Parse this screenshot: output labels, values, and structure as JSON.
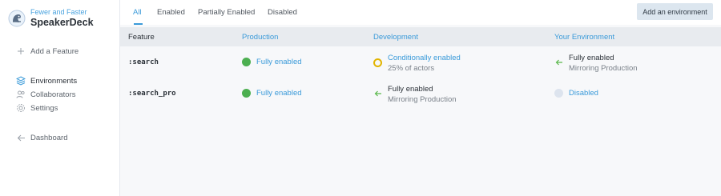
{
  "brand": {
    "org": "Fewer and Faster",
    "app": "SpeakerDeck"
  },
  "sidebar": {
    "add_feature": "Add a Feature",
    "environments": "Environments",
    "collaborators": "Collaborators",
    "settings": "Settings",
    "dashboard": "Dashboard"
  },
  "tabs": [
    "All",
    "Enabled",
    "Partially Enabled",
    "Disabled"
  ],
  "active_tab": "All",
  "add_environment_button": "Add an environment",
  "table": {
    "headers": {
      "feature": "Feature",
      "production": "Production",
      "development": "Development",
      "your_environment": "Your Environment"
    },
    "rows": [
      {
        "feature": ":search",
        "production": {
          "status": "Fully enabled",
          "icon": "green-dot-icon"
        },
        "development": {
          "status": "Conditionally enabled",
          "detail": "25% of actors",
          "icon": "yellow-ring-icon"
        },
        "your_environment": {
          "status": "Fully enabled",
          "detail": "Mirroring Production",
          "icon": "arrow-left-icon"
        }
      },
      {
        "feature": ":search_pro",
        "production": {
          "status": "Fully enabled",
          "icon": "green-dot-icon"
        },
        "development": {
          "status": "Fully enabled",
          "detail": "Mirroring Production",
          "icon": "arrow-left-icon"
        },
        "your_environment": {
          "status": "Disabled",
          "icon": "grey-dot-icon"
        }
      }
    ]
  },
  "colors": {
    "accent": "#3a9ad9",
    "enabled": "#4caf50",
    "conditional": "#e2b400",
    "mirror_arrow": "#59b84a",
    "disabled": "#dde4ee"
  }
}
